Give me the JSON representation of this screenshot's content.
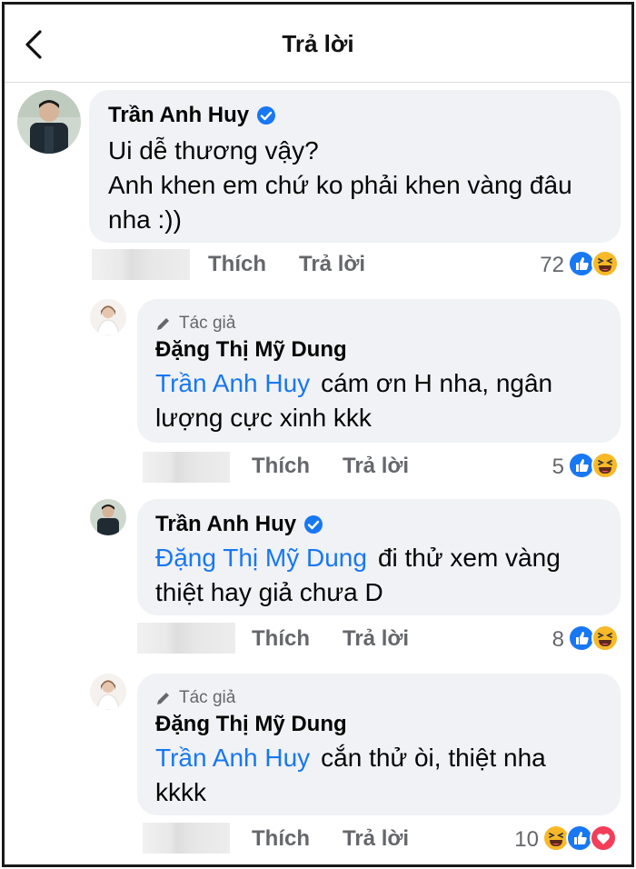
{
  "header": {
    "title": "Trả lời"
  },
  "root_comment": {
    "author": "Trần Anh Huy",
    "verified": true,
    "lines": [
      "Ui dễ thương vậy?",
      "Anh khen em chứ ko phải khen vàng đâu",
      "nha :))"
    ],
    "like_label": "Thích",
    "reply_label": "Trả lời",
    "reaction_count": "72",
    "reactions": [
      "like-icon",
      "haha-icon"
    ]
  },
  "replies": [
    {
      "author_badge": "Tác giả",
      "author": "Đặng Thị Mỹ Dung",
      "mention": "Trần Anh Huy",
      "line1": "cám ơn H nha, ngân",
      "line2": "lượng cực xinh kkk",
      "like_label": "Thích",
      "reply_label": "Trả lời",
      "reaction_count": "5",
      "reactions": [
        "like-icon",
        "haha-icon"
      ]
    },
    {
      "author": "Trần Anh Huy",
      "verified": true,
      "mention": "Đặng Thị Mỹ Dung",
      "line1": "đi thử xem vàng",
      "line2": "thiệt hay giả chưa D",
      "like_label": "Thích",
      "reply_label": "Trả lời",
      "reaction_count": "8",
      "reactions": [
        "like-icon",
        "haha-icon"
      ]
    },
    {
      "author_badge": "Tác giả",
      "author": "Đặng Thị Mỹ Dung",
      "mention": "Trần Anh Huy",
      "line1": "cắn thử òi, thiệt nha",
      "line2": "kkkk",
      "like_label": "Thích",
      "reply_label": "Trả lời",
      "reaction_count": "10",
      "reactions": [
        "haha-icon",
        "like-icon",
        "love-icon"
      ]
    }
  ],
  "colors": {
    "mention": "#1877f2",
    "like": "#1877f2",
    "haha": "#f7b928",
    "love": "#f33e58",
    "bubble": "#f0f2f5",
    "meta": "#65676b"
  }
}
